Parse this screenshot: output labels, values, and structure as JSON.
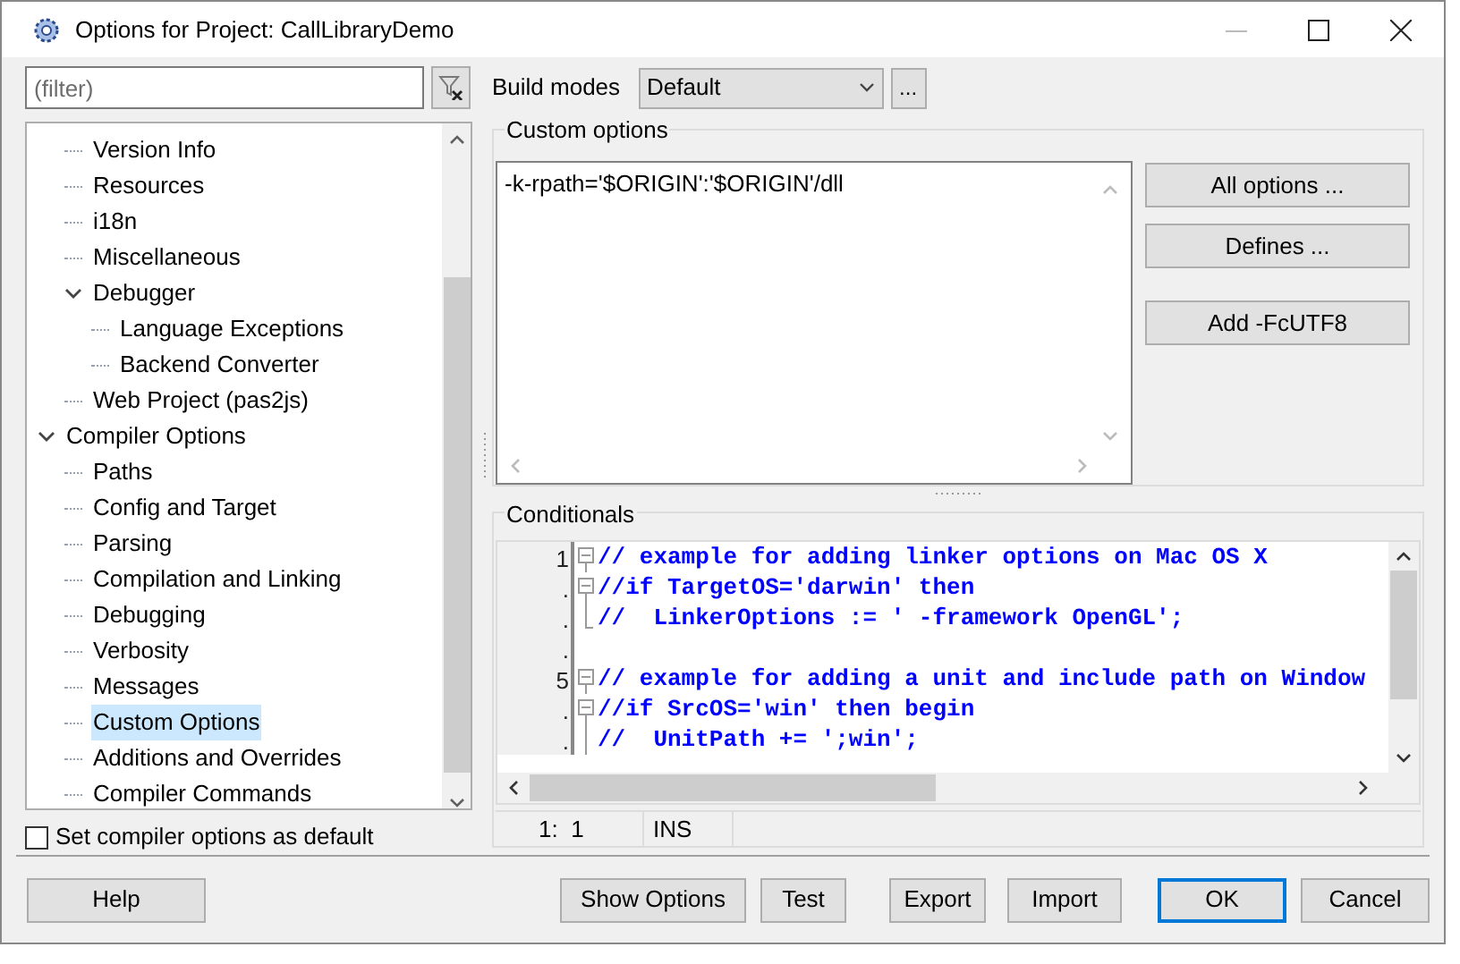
{
  "window": {
    "title": "Options for Project: CallLibraryDemo"
  },
  "filter": {
    "placeholder": "(filter)"
  },
  "build_modes": {
    "label": "Build modes",
    "value": "Default",
    "more_button": "..."
  },
  "tree": {
    "partial_branch": [
      {
        "label": "Version Info",
        "selected": false
      },
      {
        "label": "Resources",
        "selected": false
      },
      {
        "label": "i18n",
        "selected": false
      },
      {
        "label": "Miscellaneous",
        "selected": false
      },
      {
        "label": "Debugger",
        "selected": false,
        "expanded": true,
        "children": [
          {
            "label": "Language Exceptions",
            "selected": false
          },
          {
            "label": "Backend Converter",
            "selected": false
          }
        ]
      },
      {
        "label": "Web Project (pas2js)",
        "selected": false
      }
    ],
    "items": [
      {
        "label": "Compiler Options",
        "selected": false,
        "expanded": true,
        "children": [
          {
            "label": "Paths",
            "selected": false
          },
          {
            "label": "Config and Target",
            "selected": false
          },
          {
            "label": "Parsing",
            "selected": false
          },
          {
            "label": "Compilation and Linking",
            "selected": false
          },
          {
            "label": "Debugging",
            "selected": false
          },
          {
            "label": "Verbosity",
            "selected": false
          },
          {
            "label": "Messages",
            "selected": false
          },
          {
            "label": "Custom Options",
            "selected": true
          },
          {
            "label": "Additions and Overrides",
            "selected": false
          },
          {
            "label": "Compiler Commands",
            "selected": false
          }
        ]
      }
    ]
  },
  "default_checkbox": {
    "label": "Set compiler options as default",
    "checked": false
  },
  "custom_options": {
    "title": "Custom options",
    "value": "-k-rpath='$ORIGIN':'$ORIGIN'/dll",
    "buttons": [
      "All options ...",
      "Defines ...",
      "Add -FcUTF8"
    ]
  },
  "conditionals": {
    "title": "Conditionals",
    "lines": [
      {
        "number": "1",
        "kind": "start",
        "text": "// example for adding linker options on Mac OS X"
      },
      {
        "number": ".",
        "kind": "start",
        "text": "//if TargetOS='darwin' then"
      },
      {
        "number": ".",
        "kind": "end",
        "text": "//  LinkerOptions := ' -framework OpenGL';"
      },
      {
        "number": "."
      },
      {
        "number": "5",
        "kind": "start",
        "text": "// example for adding a unit and include path on Window"
      },
      {
        "number": ".",
        "kind": "start",
        "text": "//if SrcOS='win' then begin"
      },
      {
        "number": ".",
        "kind": "line",
        "text": "//  UnitPath += ';win';"
      }
    ],
    "status": {
      "position": "1:  1",
      "mode": "INS"
    }
  },
  "buttons": [
    {
      "label": "Help",
      "default": false
    },
    {
      "label": "Show Options",
      "default": false
    },
    {
      "label": "Test",
      "default": false
    },
    {
      "label": "Export",
      "default": false
    },
    {
      "label": "Import",
      "default": false
    },
    {
      "label": "OK",
      "default": true
    },
    {
      "label": "Cancel",
      "default": false
    }
  ]
}
